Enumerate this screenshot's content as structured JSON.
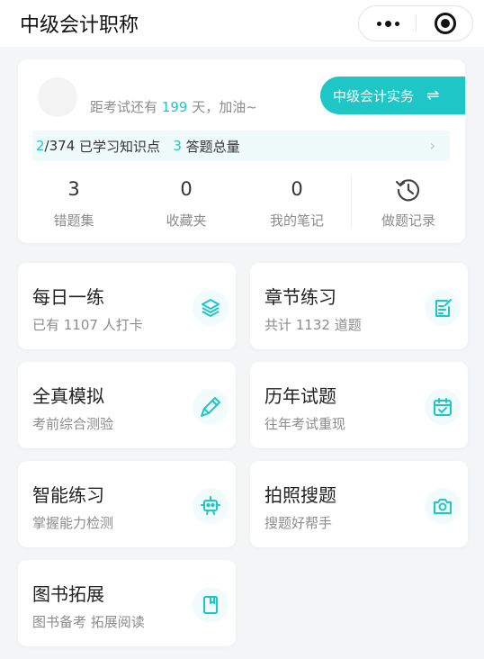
{
  "nav": {
    "title": "中级会计职称"
  },
  "overview": {
    "countdown_prefix": "距考试还有",
    "countdown_days": "199",
    "countdown_suffix": "天，加油~",
    "subject": "中级会计实务",
    "learned": "2",
    "total_points": "/374",
    "learned_label": "已学习知识点",
    "answered": "3",
    "answered_label": "答题总量",
    "stats": [
      {
        "value": "3",
        "label": "错题集"
      },
      {
        "value": "0",
        "label": "收藏夹"
      },
      {
        "value": "0",
        "label": "我的笔记"
      }
    ],
    "history_label": "做题记录"
  },
  "tiles": [
    {
      "title": "每日一练",
      "sub": "已有 1107 人打卡",
      "icon": "layers-icon"
    },
    {
      "title": "章节练习",
      "sub": "共计 1132 道题",
      "icon": "note-edit-icon"
    },
    {
      "title": "全真模拟",
      "sub": "考前综合测验",
      "icon": "pen-icon"
    },
    {
      "title": "历年试题",
      "sub": "往年考试重现",
      "icon": "calendar-check-icon"
    },
    {
      "title": "智能练习",
      "sub": "掌握能力检测",
      "icon": "robot-icon"
    },
    {
      "title": "拍照搜题",
      "sub": "搜题好帮手",
      "icon": "camera-icon"
    },
    {
      "title": "图书拓展",
      "sub": "图书备考 拓展阅读",
      "icon": "book-icon"
    }
  ],
  "colors": {
    "accent": "#1ec6c6",
    "background": "#f4f5f7",
    "card": "#ffffff"
  }
}
